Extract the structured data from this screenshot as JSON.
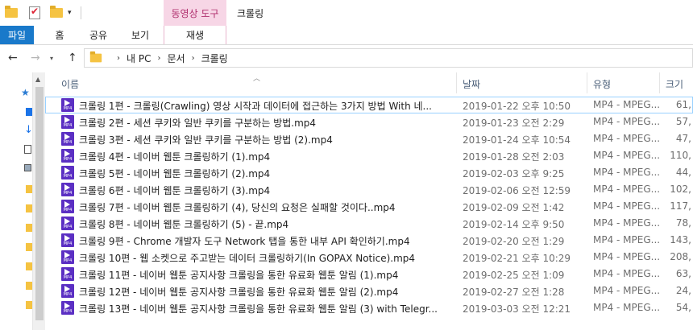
{
  "titlebar": {
    "context_tab": "동영상 도구",
    "window_title": "크롤링",
    "quick_access": [
      "folder-icon",
      "properties-check-icon",
      "new-folder-icon",
      "customize-dropdown-icon"
    ]
  },
  "ribbon": {
    "tabs": [
      {
        "label": "파일"
      },
      {
        "label": "홈"
      },
      {
        "label": "공유"
      },
      {
        "label": "보기"
      },
      {
        "label": "재생"
      }
    ],
    "file_tab_color": "#1979ca",
    "context_color": "#f7d6e6"
  },
  "address": {
    "crumbs": [
      "내 PC",
      "문서",
      "크롤링"
    ]
  },
  "columns": {
    "name": "이름",
    "date": "날짜",
    "type": "유형",
    "size": "크기"
  },
  "files": [
    {
      "name": "크롤링 1편 - 크롤링(Crawling) 영상 시작과 데이터에 접근하는 3가지 방법 With 네...",
      "date": "2019-01-22 오후 10:50",
      "type": "MP4 - MPEG...",
      "size": "61,"
    },
    {
      "name": "크롤링 2편 - 세션 쿠키와 일반 쿠키를 구분하는 방법.mp4",
      "date": "2019-01-23 오전 2:29",
      "type": "MP4 - MPEG...",
      "size": "57,"
    },
    {
      "name": "크롤링 3편 - 세션 쿠키와 일반 쿠키를 구분하는 방법 (2).mp4",
      "date": "2019-01-24 오후 10:54",
      "type": "MP4 - MPEG...",
      "size": "47,"
    },
    {
      "name": "크롤링 4편 - 네이버 웹툰 크롤링하기 (1).mp4",
      "date": "2019-01-28 오전 2:03",
      "type": "MP4 - MPEG...",
      "size": "110,"
    },
    {
      "name": "크롤링 5편 - 네이버 웹툰 크롤링하기 (2).mp4",
      "date": "2019-02-03 오후 9:25",
      "type": "MP4 - MPEG...",
      "size": "44,"
    },
    {
      "name": "크롤링 6편 - 네이버 웹툰 크롤링하기 (3).mp4",
      "date": "2019-02-06 오전 12:59",
      "type": "MP4 - MPEG...",
      "size": "102,"
    },
    {
      "name": "크롤링 7편 - 네이버 웹툰 크롤링하기 (4), 당신의 요청은 실패할 것이다..mp4",
      "date": "2019-02-09 오전 1:42",
      "type": "MP4 - MPEG...",
      "size": "117,"
    },
    {
      "name": "크롤링 8편 - 네이버 웹툰 크롤링하기 (5) - 끝.mp4",
      "date": "2019-02-14 오후 9:50",
      "type": "MP4 - MPEG...",
      "size": "78,"
    },
    {
      "name": "크롤링 9편 - Chrome 개발자 도구 Network 탭을 통한 내부 API 확인하기.mp4",
      "date": "2019-02-20 오전 1:29",
      "type": "MP4 - MPEG...",
      "size": "143,"
    },
    {
      "name": "크롤링 10편 - 웹 소켓으로 주고받는 데이터 크롤링하기(In GOPAX Notice).mp4",
      "date": "2019-02-21 오후 10:29",
      "type": "MP4 - MPEG...",
      "size": "208,"
    },
    {
      "name": "크롤링 11편 - 네이버 웹툰 공지사항 크롤링을 통한 유료화 웹툰 알림 (1).mp4",
      "date": "2019-02-25 오전 1:09",
      "type": "MP4 - MPEG...",
      "size": "63,"
    },
    {
      "name": "크롤링 12편 - 네이버 웹툰 공지사항 크롤링을 통한 유료화 웹툰 알림 (2).mp4",
      "date": "2019-02-27 오전 1:28",
      "type": "MP4 - MPEG...",
      "size": "24,"
    },
    {
      "name": "크롤링 13편 - 네이버 웹툰 공지사항 크롤링을 통한 유료화 웹툰 알림 (3) with Telegr...",
      "date": "2019-03-03 오전 12:21",
      "type": "MP4 - MPEG...",
      "size": "54,"
    }
  ],
  "selected_index": 0
}
